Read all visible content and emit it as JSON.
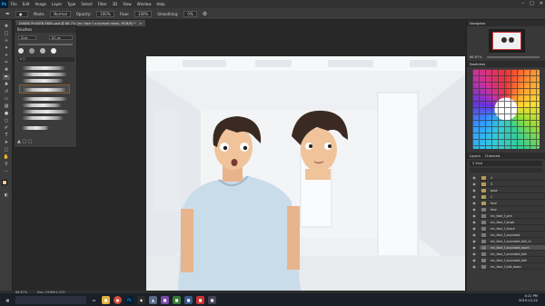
{
  "app": {
    "logo": "Ps",
    "menu": [
      "File",
      "Edit",
      "Image",
      "Layer",
      "Type",
      "Select",
      "Filter",
      "3D",
      "View",
      "Window",
      "Help"
    ]
  },
  "options_bar": {
    "mode_label": "Mode:",
    "mode_value": "Normal",
    "opacity_label": "Opacity:",
    "opacity_value": "100%",
    "flow_label": "Flow:",
    "flow_value": "100%",
    "smoothing_label": "Smoothing:",
    "smoothing_value": "0%"
  },
  "document": {
    "tab_title": "DVABS Ph4VEB 960h.psd @ 66.7% (mc face f surprised down, RGB/8) *"
  },
  "brushes_panel": {
    "title": "Brushes",
    "size_label": "Size:",
    "size_value": "61 px"
  },
  "right_panels": {
    "navigator_tab": "Navigator",
    "navigator_zoom": "66.67%",
    "swatches_tab": "Swatches",
    "layers_tab": "Layers",
    "channels_tab": "Channels",
    "kind_label": "Kind",
    "layers": [
      {
        "name": "4",
        "kind": "folder"
      },
      {
        "name": "3",
        "kind": "folder"
      },
      {
        "name": "pose",
        "kind": "folder"
      },
      {
        "name": "1",
        "kind": "folder"
      },
      {
        "name": "face",
        "kind": "folder"
      },
      {
        "name": "face",
        "kind": "layer"
      },
      {
        "name": "mc_face_f_grin",
        "kind": "layer"
      },
      {
        "name": "mc_face_f_laugh",
        "kind": "layer"
      },
      {
        "name": "mc_face_f_shock",
        "kind": "layer"
      },
      {
        "name": "mc_face_f_surprised",
        "kind": "layer"
      },
      {
        "name": "mc_face_f_surprised_talk_m",
        "kind": "layer"
      },
      {
        "name": "mc_face_f_surprised_down",
        "kind": "layer",
        "selected": true
      },
      {
        "name": "mc_face_f_surprised_talk",
        "kind": "layer"
      },
      {
        "name": "mc_face_f_surprised_talk",
        "kind": "layer"
      },
      {
        "name": "mc_face_f_talk_down",
        "kind": "layer"
      }
    ]
  },
  "status_bar": {
    "zoom": "66.67%",
    "doc_size": "Doc: 19.8M/1.07G"
  },
  "taskbar": {
    "time": "4:21 PM",
    "date": "2019-12-22"
  },
  "colors": {
    "accent": "#31a8ff",
    "canvas_bg": "#f2f3f5",
    "shirt": "#c9dcea",
    "hair": "#3a2a22",
    "skin": "#f0c39b"
  }
}
